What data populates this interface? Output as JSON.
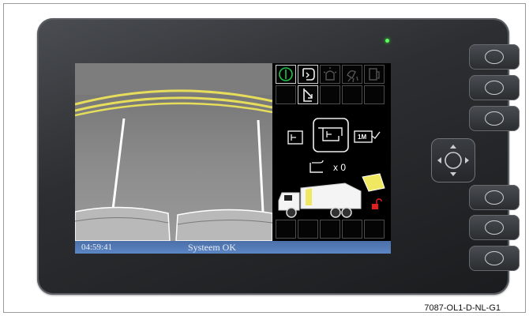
{
  "status": {
    "time": "04:59:41",
    "message": "Systeem OK"
  },
  "panel": {
    "counter_text": "x 0",
    "mode_label": "1M"
  },
  "side_buttons": [
    "button-1",
    "button-2",
    "button-3",
    "button-4",
    "button-5",
    "button-6"
  ],
  "colors": {
    "led": "#5cff5c",
    "status_bar": "#5c86c4",
    "active_icon": "#22c34a",
    "lock": "#e02020",
    "bin": "#f0e860"
  },
  "caption": "7087-OL1-D-NL-G1"
}
